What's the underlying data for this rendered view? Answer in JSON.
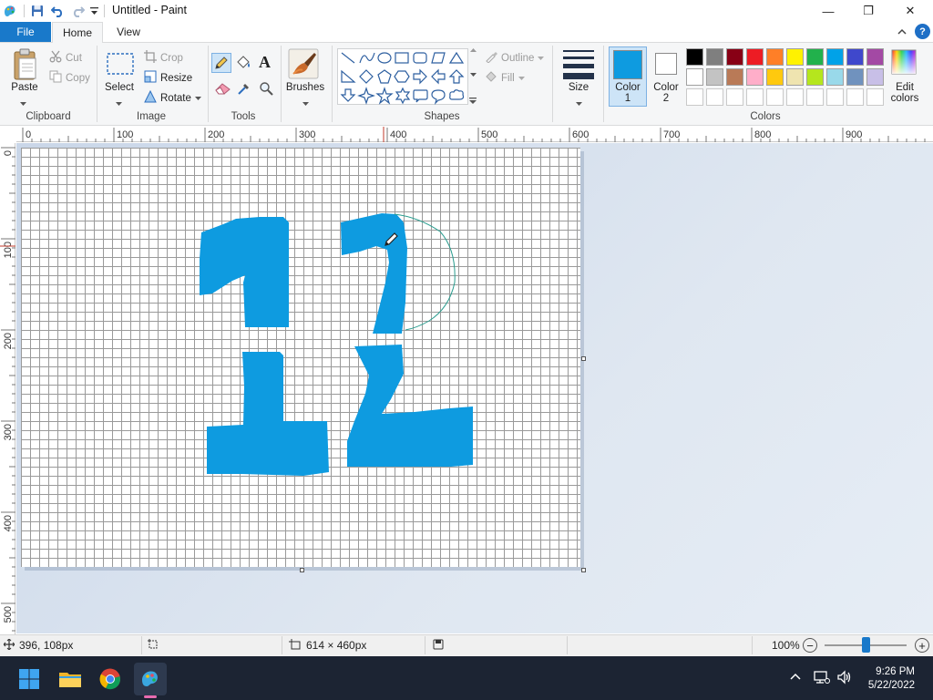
{
  "window": {
    "title": "Untitled - Paint",
    "minimize": "—",
    "maximize": "❐",
    "close": "✕"
  },
  "tabs": {
    "file": "File",
    "home": "Home",
    "view": "View",
    "help": "?"
  },
  "ribbon": {
    "clipboard": {
      "group": "Clipboard",
      "paste": "Paste",
      "cut": "Cut",
      "copy": "Copy"
    },
    "image": {
      "group": "Image",
      "select": "Select",
      "crop": "Crop",
      "resize": "Resize",
      "rotate": "Rotate"
    },
    "tools": {
      "group": "Tools"
    },
    "brushes": {
      "label": "Brushes"
    },
    "shapes": {
      "group": "Shapes",
      "outline": "Outline",
      "fill": "Fill"
    },
    "size": {
      "label": "Size"
    },
    "color1": {
      "label_line1": "Color",
      "label_line2": "1",
      "value": "#0e9be0"
    },
    "color2": {
      "label_line1": "Color",
      "label_line2": "2",
      "value": "#ffffff"
    },
    "colors": {
      "group": "Colors",
      "edit_line1": "Edit",
      "edit_line2": "colors"
    }
  },
  "palette": {
    "row1": [
      "#000000",
      "#7f7f7f",
      "#880015",
      "#ed1c24",
      "#ff7f27",
      "#fff200",
      "#22b14c",
      "#00a2e8",
      "#3f48cc",
      "#a349a4"
    ],
    "row2": [
      "#ffffff",
      "#c3c3c3",
      "#b97a57",
      "#ffaec9",
      "#ffc90e",
      "#efe4b0",
      "#b5e61d",
      "#99d9ea",
      "#7092be",
      "#c8bfe7"
    ]
  },
  "ruler": {
    "top": [
      "0",
      "100",
      "200",
      "300",
      "400",
      "500",
      "600",
      "700",
      "800",
      "900"
    ],
    "left": [
      "0",
      "100",
      "200",
      "300",
      "400",
      "500"
    ]
  },
  "canvas": {
    "stroke_color": "#0e9be0",
    "outline_color": "#2a9d8f"
  },
  "status": {
    "cursor_pos": "396, 108px",
    "canvas_size": "614 × 460px",
    "zoom": "100%",
    "zoom_out": "−",
    "zoom_in": "+",
    "zoom_level": 1.0
  },
  "taskbar": {
    "time": "9:26 PM",
    "date": "5/22/2022",
    "apps": [
      "start-icon",
      "file-explorer-icon",
      "chrome-icon",
      "paint-icon"
    ]
  }
}
